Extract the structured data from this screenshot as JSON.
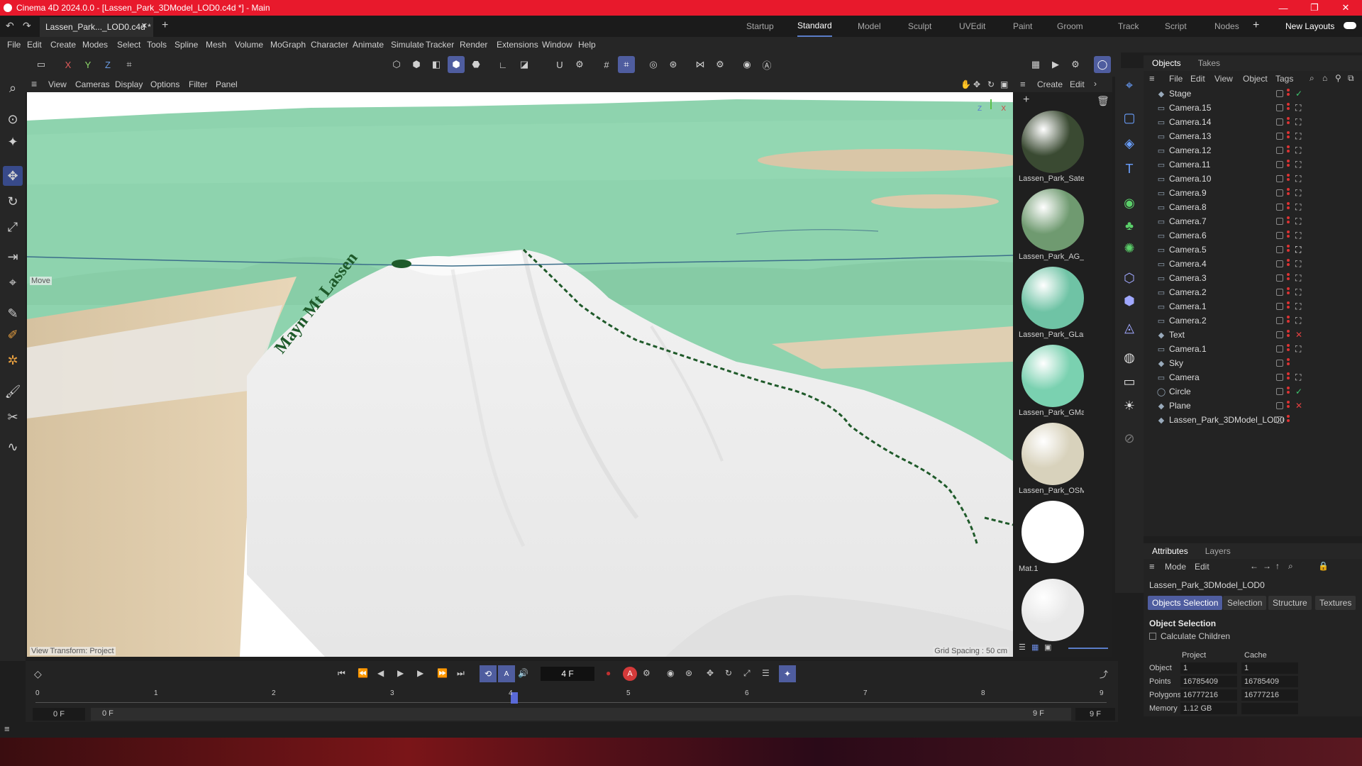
{
  "titlebar": {
    "title": "Cinema 4D 2024.0.0 - [Lassen_Park_3DModel_LOD0.c4d *] - Main"
  },
  "doc_tab": {
    "label": "Lassen_Park..._LOD0.c4d *"
  },
  "layouts": [
    "Startup",
    "Standard",
    "Model",
    "Sculpt",
    "UVEdit",
    "Paint",
    "Groom",
    "Track",
    "Script",
    "Nodes"
  ],
  "layout_active": "Standard",
  "new_layouts": "New Layouts",
  "menu": [
    "File",
    "Edit",
    "Create",
    "Modes",
    "Select",
    "Tools",
    "Spline",
    "Mesh",
    "Volume",
    "MoGraph",
    "Character",
    "Animate",
    "Simulate",
    "Tracker",
    "Render",
    "Extensions",
    "Window",
    "Help"
  ],
  "axis_labels": {
    "x": "X",
    "y": "Y",
    "z": "Z"
  },
  "viewport_menu": [
    "View",
    "Cameras",
    "Display",
    "Options",
    "Filter",
    "Panel"
  ],
  "viewport": {
    "move_label": "Move",
    "view_transform": "View Transform: Project",
    "grid_spacing": "Grid Spacing : 50 cm",
    "terrain_text": "Mayn Mt Lassen"
  },
  "material_menu": [
    "Create",
    "Edit"
  ],
  "materials": [
    {
      "name": "Lassen_Park_Satel",
      "color": "#3a4a32"
    },
    {
      "name": "Lassen_Park_AG_L",
      "color": "#6f9a70"
    },
    {
      "name": "Lassen_Park_GLan",
      "color": "#6fc3a5"
    },
    {
      "name": "Lassen_Park_GMa",
      "color": "#7ad1b0"
    },
    {
      "name": "Lassen_Park_OSM",
      "color": "#d8d2bc"
    },
    {
      "name": "Mat.1",
      "color": "#ffffff"
    },
    {
      "name": "",
      "color": "#e8e8e8"
    }
  ],
  "objects_panel": {
    "tabs": [
      "Objects",
      "Takes"
    ],
    "menu": [
      "File",
      "Edit",
      "View",
      "Object",
      "Tags"
    ],
    "items": [
      {
        "name": "Stage",
        "tag": "✓",
        "tag_color": "#3ec46d"
      },
      {
        "name": "Camera.15",
        "tag": "⛶",
        "tag_color": "#ccc"
      },
      {
        "name": "Camera.14",
        "tag": "⛶",
        "tag_color": "#ccc"
      },
      {
        "name": "Camera.13",
        "tag": "⛶",
        "tag_color": "#ccc"
      },
      {
        "name": "Camera.12",
        "tag": "⛶",
        "tag_color": "#ccc"
      },
      {
        "name": "Camera.11",
        "tag": "⛶",
        "tag_color": "#ccc"
      },
      {
        "name": "Camera.10",
        "tag": "⛶",
        "tag_color": "#ccc"
      },
      {
        "name": "Camera.9",
        "tag": "⛶",
        "tag_color": "#ccc"
      },
      {
        "name": "Camera.8",
        "tag": "⛶",
        "tag_color": "#ccc"
      },
      {
        "name": "Camera.7",
        "tag": "⛶",
        "tag_color": "#ccc"
      },
      {
        "name": "Camera.6",
        "tag": "⛶",
        "tag_color": "#ccc"
      },
      {
        "name": "Camera.5",
        "tag": "⛶",
        "tag_color": "#fff"
      },
      {
        "name": "Camera.4",
        "tag": "⛶",
        "tag_color": "#ccc"
      },
      {
        "name": "Camera.3",
        "tag": "⛶",
        "tag_color": "#ccc"
      },
      {
        "name": "Camera.2",
        "tag": "⛶",
        "tag_color": "#ccc"
      },
      {
        "name": "Camera.1",
        "tag": "⛶",
        "tag_color": "#ccc"
      },
      {
        "name": "Camera.2",
        "tag": "⛶",
        "tag_color": "#ccc"
      },
      {
        "name": "Text",
        "tag": "✕",
        "tag_color": "#e04040"
      },
      {
        "name": "Camera.1",
        "tag": "⛶",
        "tag_color": "#ccc"
      },
      {
        "name": "Sky",
        "tag": "",
        "tag_color": "#ccc"
      },
      {
        "name": "Camera",
        "tag": "⛶",
        "tag_color": "#ccc"
      },
      {
        "name": "Circle",
        "tag": "✓",
        "tag_color": "#3ec46d"
      },
      {
        "name": "Plane",
        "tag": "✕",
        "tag_color": "#e04040"
      },
      {
        "name": "Lassen_Park_3DModel_LOD0",
        "tag": "",
        "tag_color": "#ccc"
      }
    ]
  },
  "attributes_panel": {
    "tabs": [
      "Attributes",
      "Layers"
    ],
    "menu": [
      "Mode",
      "Edit"
    ],
    "object_name": "Lassen_Park_3DModel_LOD0",
    "subtabs": [
      "Objects Selection",
      "Selection",
      "Structure",
      "Textures"
    ],
    "section": "Object Selection",
    "calc_children": "Calculate Children",
    "col_project": "Project",
    "col_cache": "Cache",
    "rows": [
      {
        "label": "Object",
        "project": "1",
        "cache": "1"
      },
      {
        "label": "Points",
        "project": "16785409",
        "cache": "16785409"
      },
      {
        "label": "Polygons",
        "project": "16777216",
        "cache": "16777216"
      },
      {
        "label": "Memory",
        "project": "1.12 GB",
        "cache": ""
      }
    ]
  },
  "timeline": {
    "current_frame": "4 F",
    "ticks": [
      "0",
      "1",
      "2",
      "3",
      "4",
      "5",
      "6",
      "7",
      "8",
      "9"
    ],
    "start_a": "0 F",
    "start_b": "0 F",
    "end_a": "9 F",
    "end_b": "9 F"
  }
}
